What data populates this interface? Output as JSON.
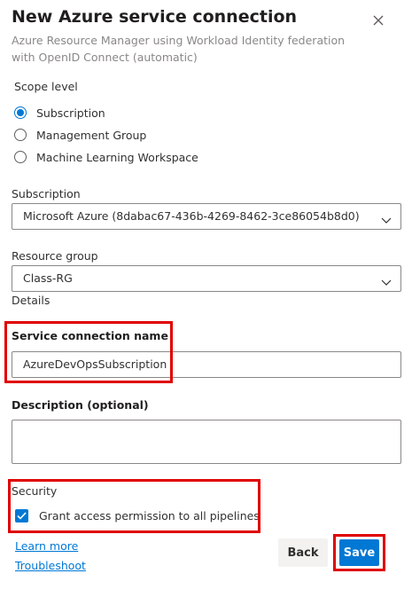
{
  "dialog": {
    "title": "New Azure service connection",
    "subtitle": "Azure Resource Manager using Workload Identity federation with OpenID Connect (automatic)"
  },
  "scope": {
    "label": "Scope level",
    "options": [
      {
        "label": "Subscription",
        "selected": true
      },
      {
        "label": "Management Group",
        "selected": false
      },
      {
        "label": "Machine Learning Workspace",
        "selected": false
      }
    ]
  },
  "subscription": {
    "label": "Subscription",
    "value": "Microsoft Azure (8dabac67-436b-4269-8462-3ce86054b8d0)"
  },
  "resource_group": {
    "label": "Resource group",
    "value": "Class-RG"
  },
  "details_label": "Details",
  "connection_name": {
    "label": "Service connection name",
    "value": "AzureDevOpsSubscription"
  },
  "description": {
    "label": "Description (optional)",
    "value": ""
  },
  "security": {
    "label": "Security",
    "grant_access_label": "Grant access permission to all pipelines",
    "grant_access_checked": true
  },
  "links": {
    "learn_more": "Learn more",
    "troubleshoot": "Troubleshoot"
  },
  "buttons": {
    "back": "Back",
    "save": "Save"
  },
  "colors": {
    "accent": "#0078d4",
    "highlight": "#e00000"
  }
}
